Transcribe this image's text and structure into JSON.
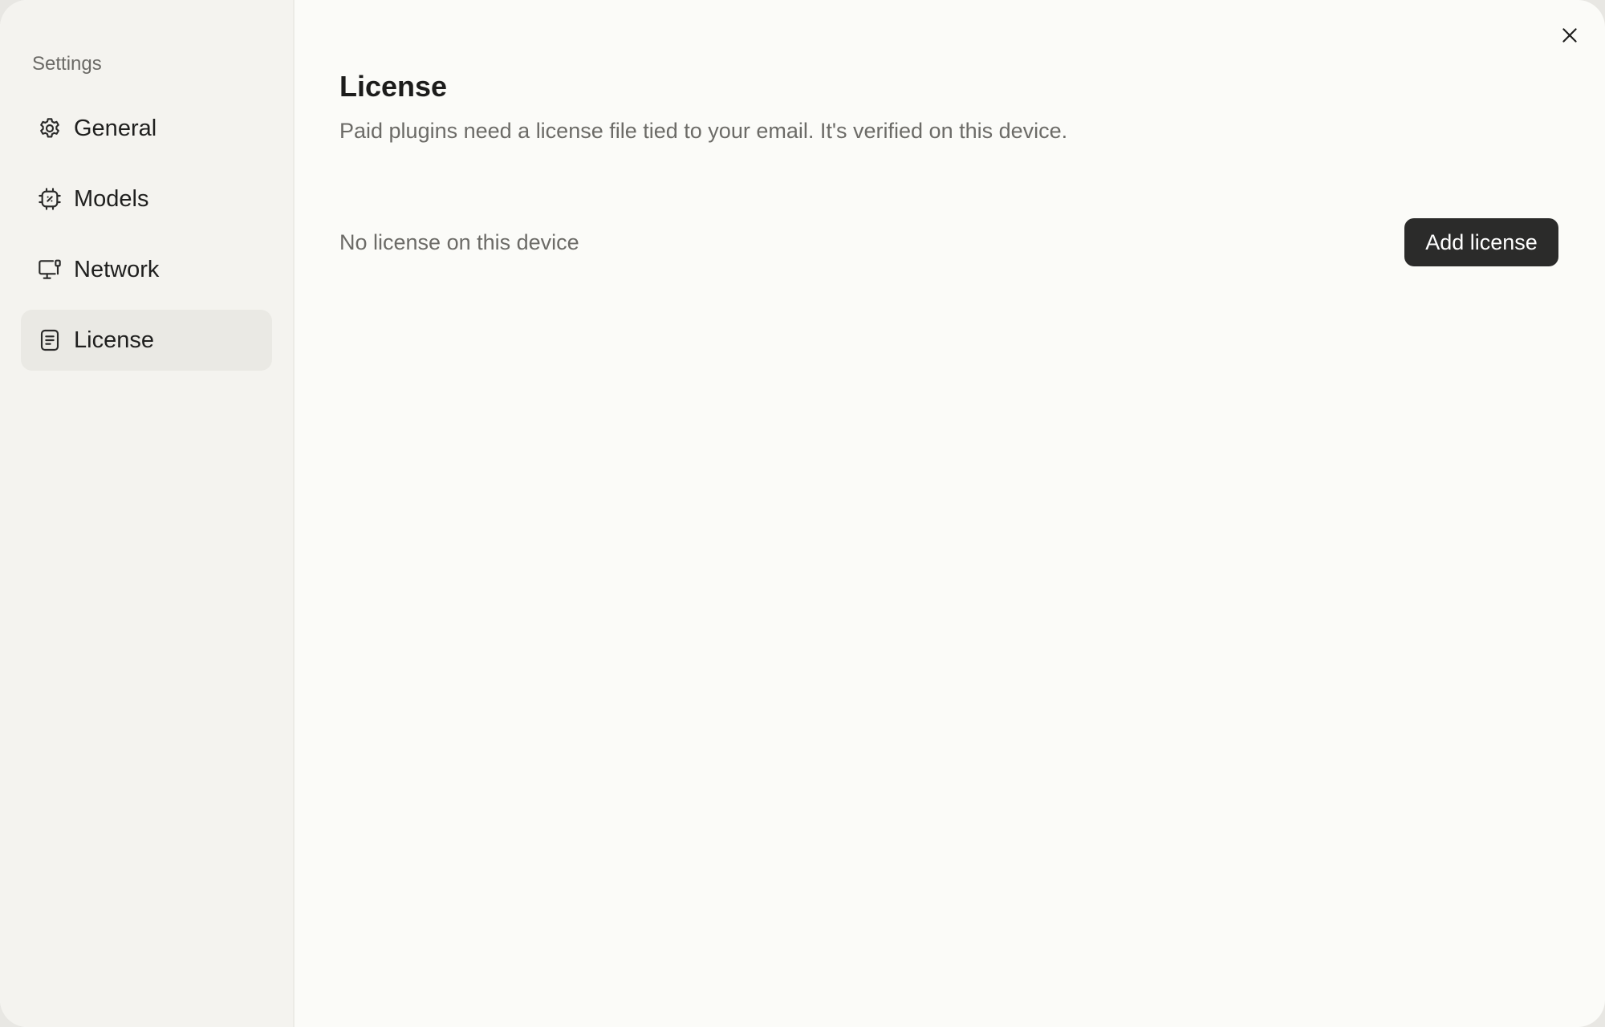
{
  "sidebar": {
    "heading": "Settings",
    "items": [
      {
        "label": "General",
        "icon": "gear-icon",
        "active": false
      },
      {
        "label": "Models",
        "icon": "chip-icon",
        "active": false
      },
      {
        "label": "Network",
        "icon": "monitor-network-icon",
        "active": false
      },
      {
        "label": "License",
        "icon": "document-icon",
        "active": true
      }
    ]
  },
  "main": {
    "title": "License",
    "description": "Paid plugins need a license file tied to your email. It's verified on this device.",
    "status": "No license on this device",
    "add_button_label": "Add license"
  },
  "colors": {
    "sidebar_bg": "#f4f3ef",
    "main_bg": "#fbfbf8",
    "active_item_bg": "#eae9e4",
    "button_bg": "#2b2b2a",
    "muted_text": "#6c6b67"
  }
}
